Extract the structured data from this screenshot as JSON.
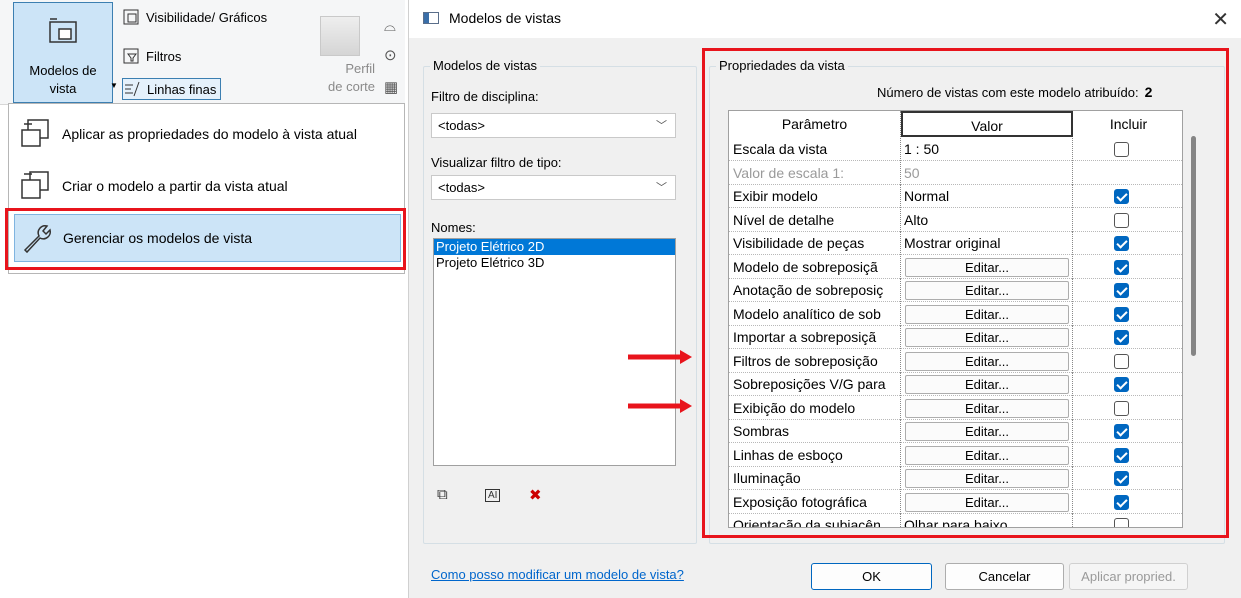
{
  "ribbon": {
    "models_button_label_1": "Modelos de",
    "models_button_label_2": "vista",
    "visibility_label": "Visibilidade/ Gráficos",
    "filters_label": "Filtros",
    "thin_lines_label": "Linhas finas",
    "profile_label_1": "Perfil",
    "profile_label_2": "de corte"
  },
  "dropdown": {
    "items": [
      {
        "label": "Aplicar as propriedades do modelo à vista atual",
        "icon": "apply-template-icon"
      },
      {
        "label": "Criar o modelo a partir da vista atual",
        "icon": "create-template-icon"
      },
      {
        "label": "Gerenciar os modelos de vista",
        "icon": "wrench-icon"
      }
    ]
  },
  "dialog": {
    "title": "Modelos de vistas",
    "left_group": "Modelos de vistas",
    "discipline_filter_label": "Filtro de disciplina:",
    "discipline_filter_value": "<todas>",
    "type_filter_label": "Visualizar filtro de tipo:",
    "type_filter_value": "<todas>",
    "names_label": "Nomes:",
    "names": [
      "Projeto Elétrico 2D",
      "Projeto Elétrico 3D"
    ],
    "right_group": "Propriedades da vista",
    "count_label": "Número de vistas com este modelo atribuído:",
    "count_value": "2",
    "table": {
      "headers": [
        "Parâmetro",
        "Valor",
        "Incluir"
      ],
      "rows": [
        {
          "param": "Escala da vista",
          "value": "1 : 50",
          "type": "text",
          "checked": false
        },
        {
          "param": "Valor de escala    1:",
          "value": "50",
          "type": "disabled",
          "checked": null
        },
        {
          "param": "Exibir modelo",
          "value": "Normal",
          "type": "text",
          "checked": true
        },
        {
          "param": "Nível de detalhe",
          "value": "Alto",
          "type": "text",
          "checked": false
        },
        {
          "param": "Visibilidade de peças",
          "value": "Mostrar original",
          "type": "text",
          "checked": true
        },
        {
          "param": "Modelo de sobreposiçã",
          "value": "Editar...",
          "type": "button",
          "checked": true
        },
        {
          "param": "Anotação de sobreposiç",
          "value": "Editar...",
          "type": "button",
          "checked": true
        },
        {
          "param": "Modelo analítico de sob",
          "value": "Editar...",
          "type": "button",
          "checked": true
        },
        {
          "param": "Importar a sobreposiçã",
          "value": "Editar...",
          "type": "button",
          "checked": true
        },
        {
          "param": "Filtros de sobreposição",
          "value": "Editar...",
          "type": "button",
          "checked": false
        },
        {
          "param": "Sobreposições V/G para",
          "value": "Editar...",
          "type": "button",
          "checked": true
        },
        {
          "param": "Exibição do modelo",
          "value": "Editar...",
          "type": "button",
          "checked": false
        },
        {
          "param": "Sombras",
          "value": "Editar...",
          "type": "button",
          "checked": true
        },
        {
          "param": "Linhas de esboço",
          "value": "Editar...",
          "type": "button",
          "checked": true
        },
        {
          "param": "Iluminação",
          "value": "Editar...",
          "type": "button",
          "checked": true
        },
        {
          "param": "Exposição fotográfica",
          "value": "Editar...",
          "type": "button",
          "checked": true
        },
        {
          "param": "Orientação da subjacên",
          "value": "Olhar para baixo",
          "type": "text",
          "checked": false
        }
      ]
    },
    "help_link": "Como posso modificar um modelo de vista?",
    "ok_label": "OK",
    "cancel_label": "Cancelar",
    "apply_label": "Aplicar propried."
  },
  "colors": {
    "annotation_red": "#e8141c",
    "selection_blue": "#0078d7",
    "checkbox_blue": "#0067c0"
  }
}
